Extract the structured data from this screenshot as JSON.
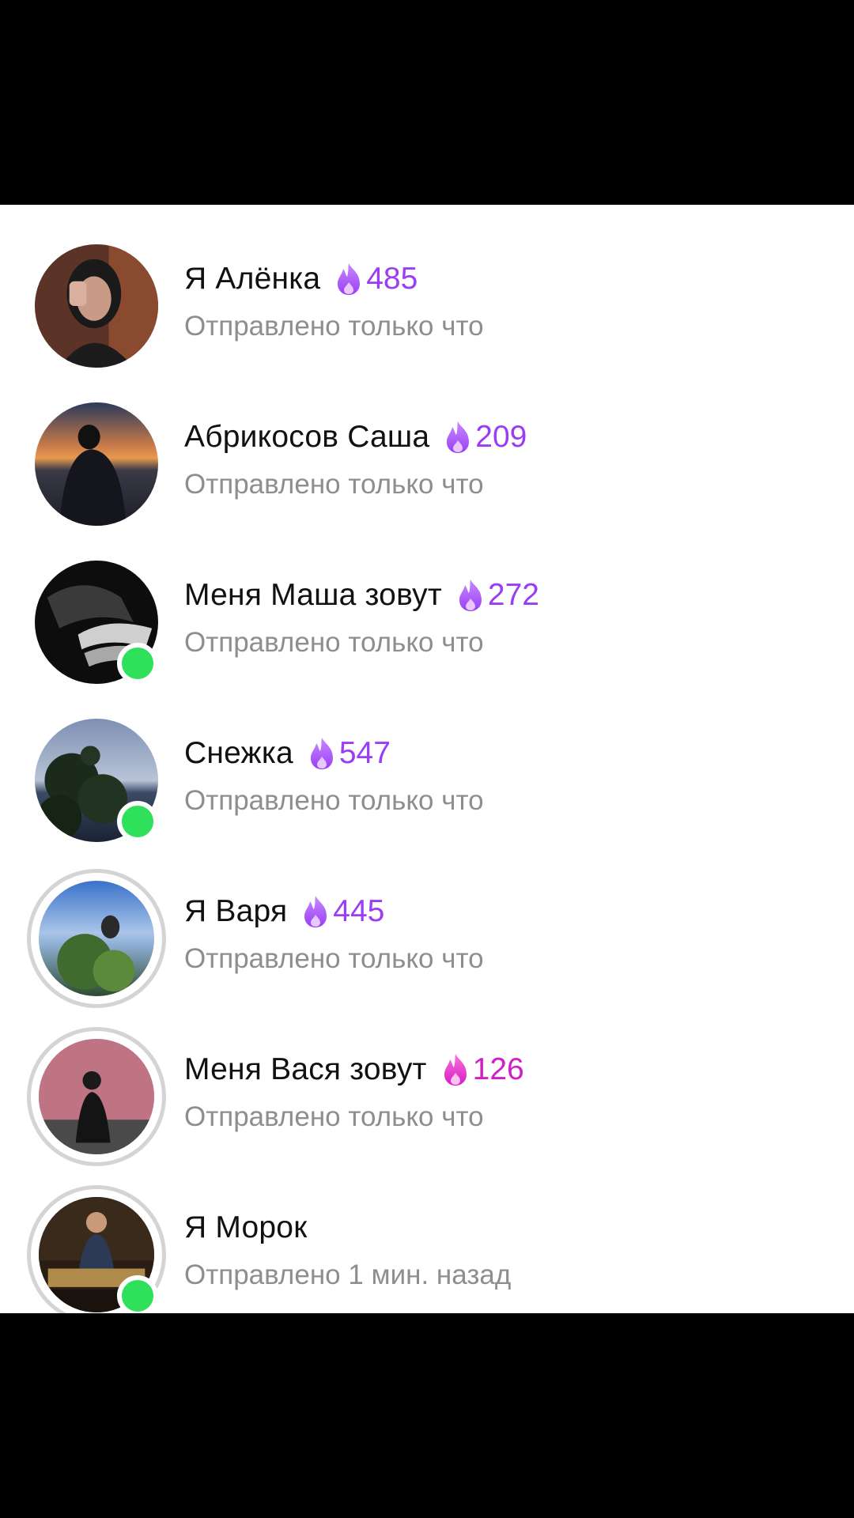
{
  "colors": {
    "streak_purple": "#9b3df5",
    "streak_pink": "#d21ec9",
    "online_green": "#2ee05a",
    "status_gray": "#8e8e8e"
  },
  "chats": [
    {
      "name": "Я Алёнка",
      "streak": "485",
      "status": "Отправлено только что",
      "online": false,
      "ring": false,
      "flame": "purple"
    },
    {
      "name": "Абрикосов Саша",
      "streak": "209",
      "status": "Отправлено только что",
      "online": false,
      "ring": false,
      "flame": "purple"
    },
    {
      "name": "Меня Маша зовут",
      "streak": "272",
      "status": "Отправлено только что",
      "online": true,
      "ring": false,
      "flame": "purple"
    },
    {
      "name": "Снежка",
      "streak": "547",
      "status": "Отправлено только что",
      "online": true,
      "ring": false,
      "flame": "purple"
    },
    {
      "name": "Я Варя",
      "streak": "445",
      "status": "Отправлено только что",
      "online": false,
      "ring": true,
      "flame": "purple"
    },
    {
      "name": "Меня Вася зовут",
      "streak": "126",
      "status": "Отправлено только что",
      "online": false,
      "ring": true,
      "flame": "pink"
    },
    {
      "name": "Я Морок",
      "streak": null,
      "status": "Отправлено 1 мин. назад",
      "online": true,
      "ring": true,
      "flame": null
    }
  ]
}
